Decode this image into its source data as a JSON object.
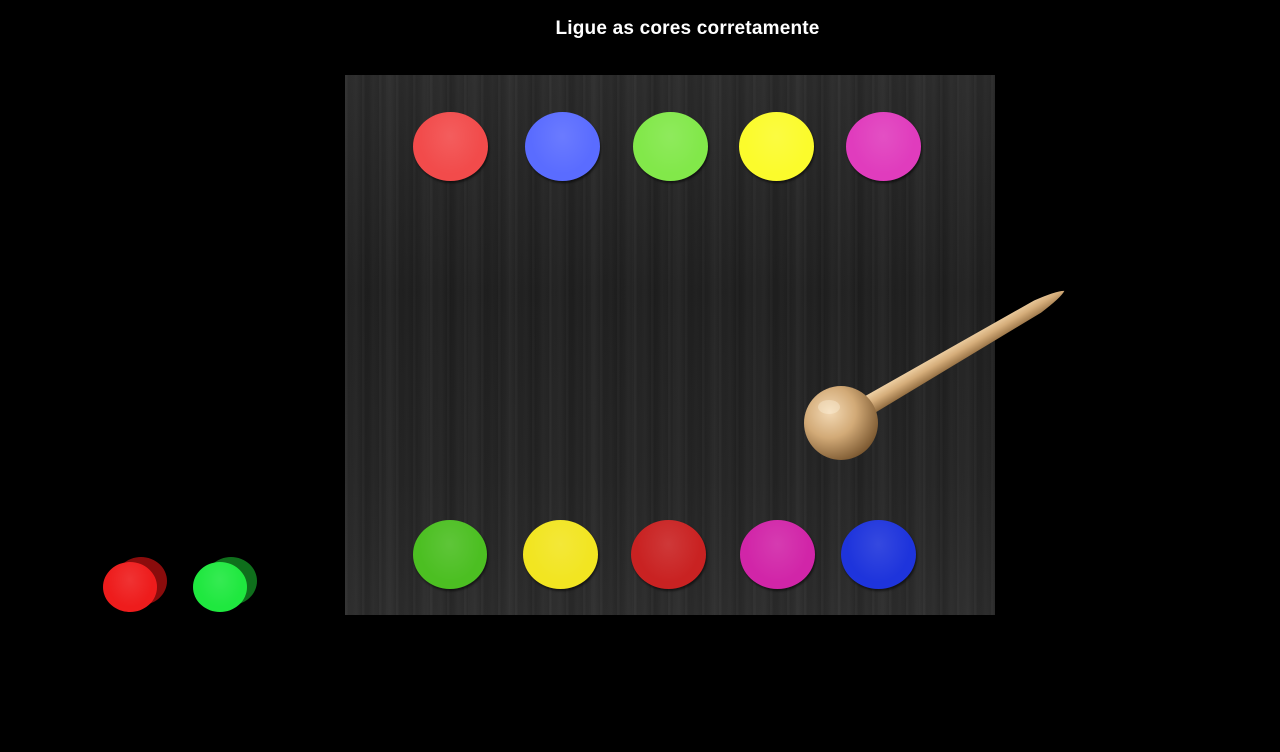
{
  "title": "Ligue as cores corretamente",
  "top_circles": [
    {
      "name": "red",
      "color": "#f24b4b"
    },
    {
      "name": "blue",
      "color": "#5a6cff"
    },
    {
      "name": "green",
      "color": "#82e84a"
    },
    {
      "name": "yellow",
      "color": "#fbfb2c"
    },
    {
      "name": "magenta",
      "color": "#e03cbd"
    }
  ],
  "bottom_circles": [
    {
      "name": "green",
      "color": "#4cbf22"
    },
    {
      "name": "yellow",
      "color": "#f2e521"
    },
    {
      "name": "red",
      "color": "#c92222"
    },
    {
      "name": "magenta",
      "color": "#d125a8"
    },
    {
      "name": "blue",
      "color": "#1e34dc"
    }
  ],
  "tokens": [
    {
      "name": "red",
      "color": "#ee1c1c",
      "shadow": "#8a0c0c"
    },
    {
      "name": "green",
      "color": "#1fe83f",
      "shadow": "#0f6f1c"
    }
  ],
  "mallet_icon": "wooden-mallet"
}
